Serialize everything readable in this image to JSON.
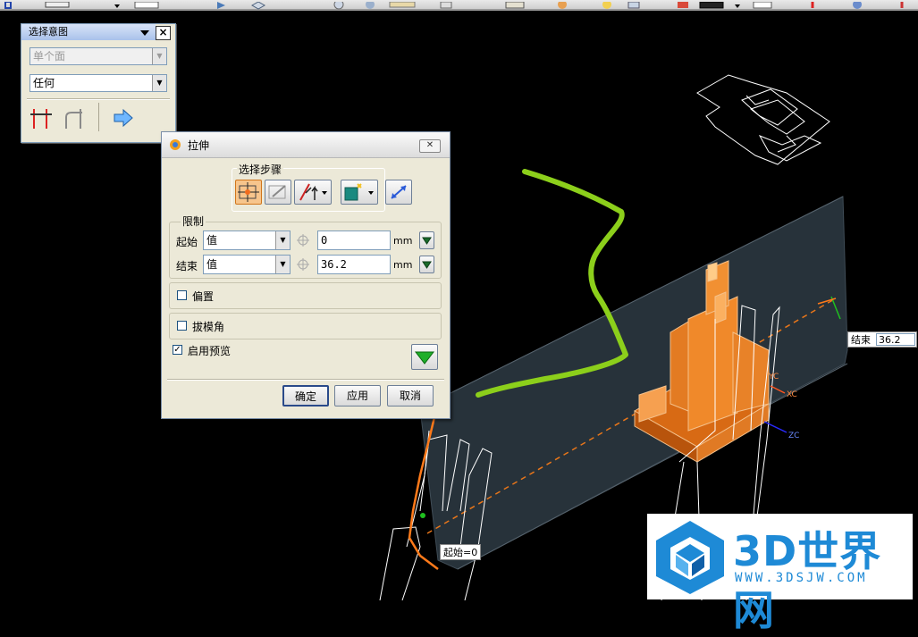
{
  "selection_bar": {
    "title": "选择意图",
    "face_rule": "单个面",
    "curve_rule": "任何"
  },
  "dialog": {
    "title": "拉伸",
    "steps_label": "选择步骤",
    "limits_label": "限制",
    "start": {
      "label": "起始",
      "type": "值",
      "value": "0",
      "unit": "mm"
    },
    "end": {
      "label": "结束",
      "type": "值",
      "value": "36.2",
      "unit": "mm"
    },
    "offset_label": "偏置",
    "draft_label": "拔模角",
    "preview_label": "启用预览",
    "preview_checked": true,
    "ok": "确定",
    "apply": "应用",
    "cancel": "取消"
  },
  "viewport": {
    "end_tag_label": "结束",
    "end_tag_value": "36.2",
    "start_tag": "起始=0",
    "axis_xc": "XC",
    "axis_yc": "YC",
    "axis_zc": "ZC"
  },
  "watermark": {
    "brand": "3D世界网",
    "url": "WWW.3DSJW.COM"
  },
  "colors": {
    "accent_orange": "#e8761a",
    "annotation_green": "#8ccf1b",
    "preview_plane": "#2b3740"
  }
}
